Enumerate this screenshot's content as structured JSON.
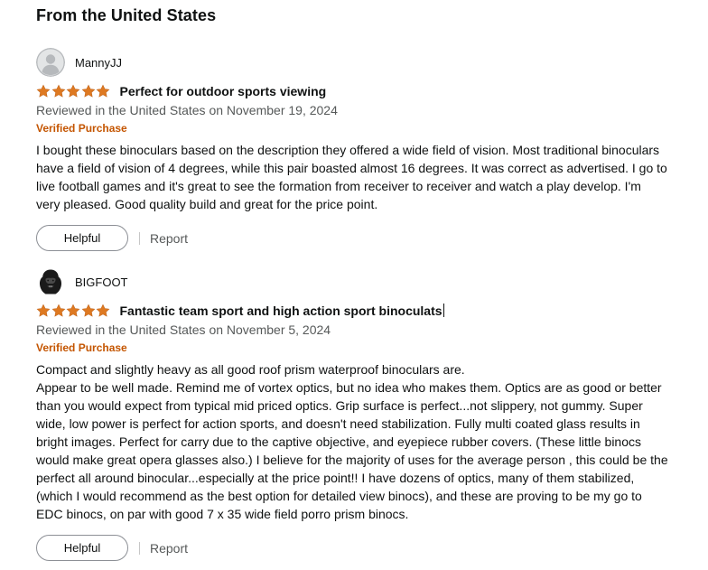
{
  "section_title": "From the United States",
  "colors": {
    "star": "#de7921",
    "verified": "#c45500",
    "meta_text": "#565959"
  },
  "reviews": [
    {
      "reviewer": "MannyJJ",
      "avatar_icon": "default-user-avatar-icon",
      "rating": 5,
      "title": "Perfect for outdoor sports viewing",
      "date": "Reviewed in the United States on November 19, 2024",
      "verified": "Verified Purchase",
      "body": [
        "I bought these binoculars based on the description they offered a wide field of vision. Most traditional binoculars have a field of vision of 4 degrees, while this pair boasted almost 16 degrees. It was correct as advertised. I go to live football games and it's great to see the formation from receiver to receiver and watch a play develop. I'm very pleased. Good quality build and great for the price point."
      ],
      "helpful_label": "Helpful",
      "report_label": "Report"
    },
    {
      "reviewer": "BIGFOOT",
      "avatar_icon": "gorilla-avatar-icon",
      "rating": 5,
      "title": "Fantastic team sport and high action sport binoculats",
      "date": "Reviewed in the United States on November 5, 2024",
      "verified": "Verified Purchase",
      "body": [
        "Compact and slightly heavy as all good roof prism waterproof binoculars are.",
        "Appear to be well made. Remind me of vortex optics, but no idea who makes them. Optics are as good or better than you would expect from typical mid priced optics. Grip surface is perfect...not slippery, not gummy. Super wide, low power is perfect for action sports, and doesn't need stabilization. Fully multi coated glass results in bright images. Perfect for carry due to the captive objective, and eyepiece rubber covers. (These little binocs would make great opera glasses also.) I believe for the majority of uses for the average person , this could be the perfect all around binocular...especially at the price point!! I have dozens of optics, many of them stabilized, (which I would recommend as the best option for detailed view binocs), and these are proving to be my go to EDC binocs, on par with good 7 x 35 wide field porro prism binocs."
      ],
      "helpful_label": "Helpful",
      "report_label": "Report"
    }
  ]
}
